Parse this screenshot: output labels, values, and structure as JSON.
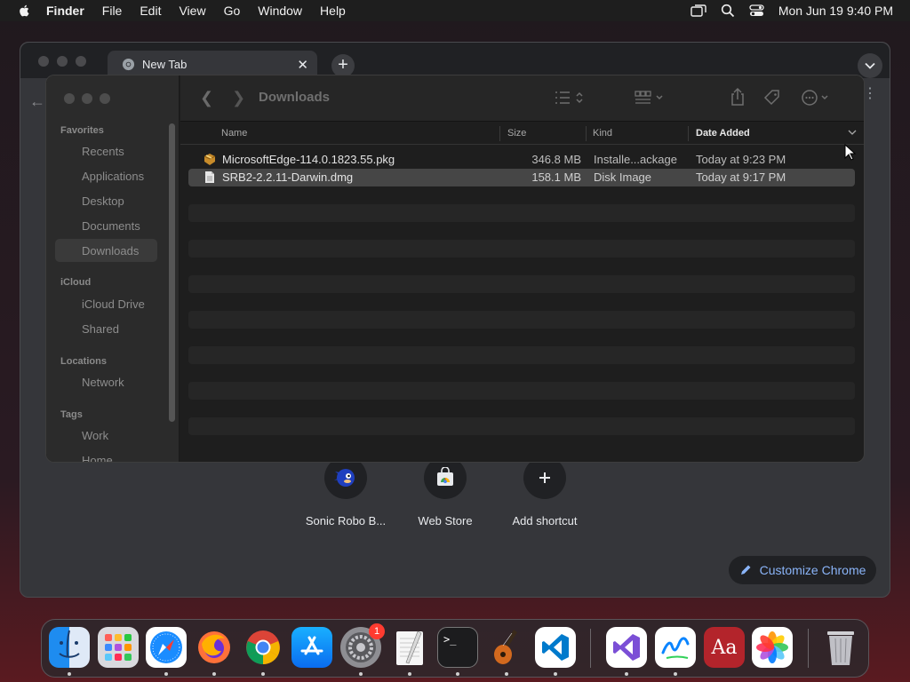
{
  "menubar": {
    "app_name": "Finder",
    "items": [
      "File",
      "Edit",
      "View",
      "Go",
      "Window",
      "Help"
    ],
    "datetime": "Mon Jun 19  9:40 PM"
  },
  "chrome": {
    "tab_title": "New Tab",
    "shortcuts": [
      {
        "label": "Sonic Robo B...",
        "icon": "sonic-icon"
      },
      {
        "label": "Web Store",
        "icon": "web-store-icon"
      },
      {
        "label": "Add shortcut",
        "icon": "plus-icon"
      }
    ],
    "customize_label": "Customize Chrome",
    "accent": "#8ab4f8"
  },
  "finder": {
    "title": "Downloads",
    "sidebar": {
      "favorites_header": "Favorites",
      "favorites": [
        "Recents",
        "Applications",
        "Desktop",
        "Documents",
        "Downloads"
      ],
      "selected": "Downloads",
      "icloud_header": "iCloud",
      "icloud": [
        "iCloud Drive",
        "Shared"
      ],
      "locations_header": "Locations",
      "locations": [
        "Network"
      ],
      "tags_header": "Tags",
      "tags": [
        "Work",
        "Home"
      ]
    },
    "columns": {
      "name": "Name",
      "size": "Size",
      "kind": "Kind",
      "date": "Date Added"
    },
    "files": [
      {
        "name": "MicrosoftEdge-114.0.1823.55.pkg",
        "size": "346.8 MB",
        "kind": "Installe...ackage",
        "date": "Today at 9:23 PM",
        "icon": "package-icon"
      },
      {
        "name": "SRB2-2.2.11-Darwin.dmg",
        "size": "158.1 MB",
        "kind": "Disk Image",
        "date": "Today at 9:17 PM",
        "icon": "document-icon"
      }
    ]
  },
  "dock": {
    "apps": [
      "Finder",
      "Launchpad",
      "Safari",
      "Firefox",
      "Chrome",
      "App Store",
      "System Settings",
      "TextEdit",
      "Terminal",
      "GarageBand",
      "VS Code",
      "Visual Studio",
      "Freeform",
      "Dictionary",
      "Photos",
      "Trash"
    ],
    "settings_badge": "1"
  }
}
